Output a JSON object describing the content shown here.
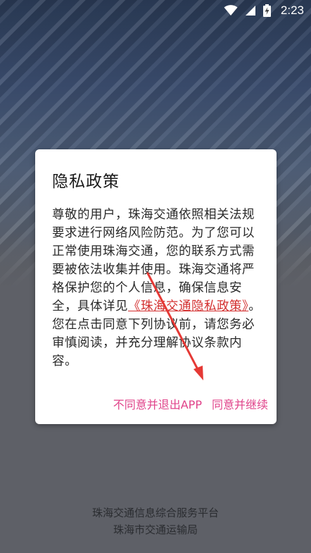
{
  "status_bar": {
    "time": "2:23",
    "icons": [
      "wifi-icon",
      "cellular-signal-icon",
      "battery-charging-icon"
    ]
  },
  "dialog": {
    "title": "隐私政策",
    "body_part1": "尊敬的用户，珠海交通依照相关法规要求进行网络风险防范。为了您可以正常使用珠海交通，您的联系方式需要被依法收集并使用。珠海交通将严格保护您的个人信息，确保信息安全，具体详见",
    "policy_link": "《珠海交通隐私政策》",
    "body_part2": "。",
    "body_part3": "您在点击同意下列协议前，请您务必审慎阅读，并充分理解协议条款内容。",
    "decline_label": "不同意并退出APP",
    "accept_label": "同意并继续"
  },
  "footer": {
    "line1": "珠海交通信息综合服务平台",
    "line2": "珠海市交通运输局"
  },
  "colors": {
    "accent": "#e0438a",
    "link": "#d32f2f",
    "annotation_arrow": "#e53935"
  }
}
